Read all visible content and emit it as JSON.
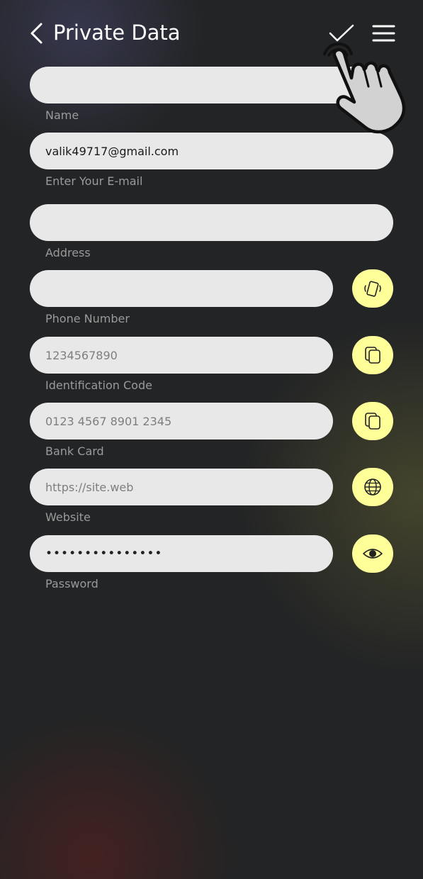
{
  "header": {
    "title": "Private Data",
    "back_icon": "chevron-left-icon",
    "confirm_icon": "check-icon",
    "menu_icon": "menu-icon"
  },
  "fields": [
    {
      "key": "name",
      "label": "Name",
      "value": "",
      "action_icon": null
    },
    {
      "key": "email",
      "label": "Enter Your E-mail",
      "value": "valik49717@gmail.com",
      "action_icon": null
    },
    {
      "key": "address",
      "label": "Address",
      "value": "",
      "action_icon": null
    },
    {
      "key": "phone",
      "label": "Phone Number",
      "value": "",
      "action_icon": "phone-vibrate-icon"
    },
    {
      "key": "id_code",
      "label": "Identification Code",
      "value": "1234567890",
      "action_icon": "copy-icon"
    },
    {
      "key": "bank_card",
      "label": "Bank Card",
      "value": "0123 4567 8901 2345",
      "action_icon": "copy-icon"
    },
    {
      "key": "website",
      "label": "Website",
      "value": "https://site.web",
      "action_icon": "globe-icon"
    },
    {
      "key": "password",
      "label": "Password",
      "value": "•••••••••••••••",
      "action_icon": "eye-icon"
    }
  ],
  "colors": {
    "background": "#232425",
    "input_fill": "#e8e8e8",
    "action_button": "#ffff9a",
    "label_text": "#9a9a9a"
  },
  "overlay": {
    "pointer_icon": "tap-hand-icon"
  }
}
